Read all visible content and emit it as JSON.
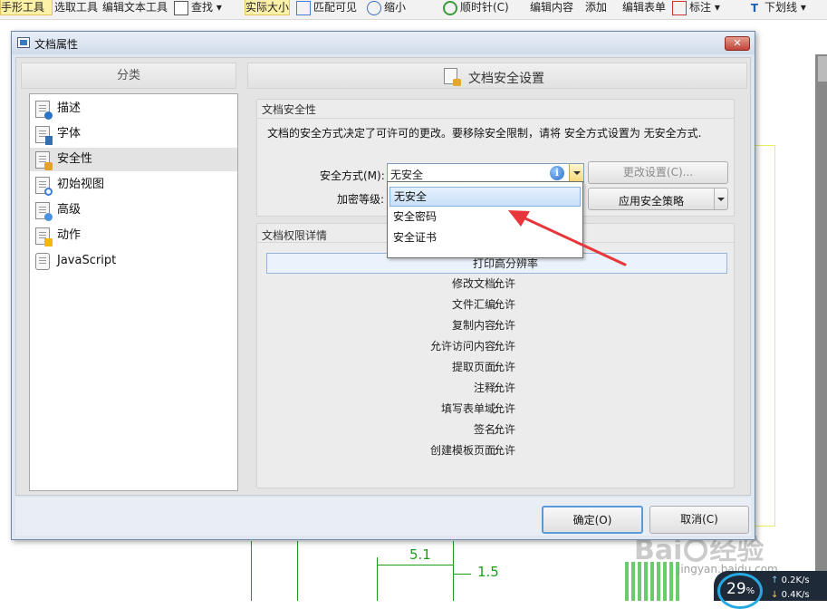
{
  "toolbar": {
    "items": [
      "手形工具",
      "选取工具",
      "编辑文本工具",
      "查找",
      "实际大小",
      "匹配可见",
      "缩小",
      "顺时针(C)",
      "编辑内容",
      "添加",
      "编辑表单",
      "标注",
      "下划线"
    ]
  },
  "dialog": {
    "title": "文档属性",
    "close_label": "✕",
    "left_header": "分类",
    "categories": [
      {
        "label": "描述",
        "icon": "info-document-icon"
      },
      {
        "label": "字体",
        "icon": "font-document-icon"
      },
      {
        "label": "安全性",
        "icon": "lock-document-icon"
      },
      {
        "label": "初始视图",
        "icon": "magnifier-document-icon"
      },
      {
        "label": "高级",
        "icon": "gear-document-icon"
      },
      {
        "label": "动作",
        "icon": "lightning-document-icon"
      },
      {
        "label": "JavaScript",
        "icon": "script-scroll-icon"
      }
    ],
    "selected_category": "安全性",
    "right_header": "文档安全设置",
    "security_group": {
      "title": "文档安全性",
      "description": "文档的安全方式决定了可许可的更改。要移除安全限制，请将 安全方式设置为 无安全方式.",
      "method_label": "安全方式(M):",
      "method_value": "无安全",
      "change_settings_label": "更改设置(C)...",
      "encryption_label": "加密等级:",
      "apply_policy_label": "应用安全策略"
    },
    "dropdown": {
      "options": [
        "无安全",
        "安全密码",
        "安全证书"
      ],
      "selected": "无安全"
    },
    "permissions_group": {
      "title": "文档权限详情",
      "rows": [
        {
          "key": "打印:",
          "value": "高分辨率"
        },
        {
          "key": "修改文档:",
          "value": "允许"
        },
        {
          "key": "文件汇编:",
          "value": "允许"
        },
        {
          "key": "复制内容:",
          "value": "允许"
        },
        {
          "key": "允许访问内容:",
          "value": "允许"
        },
        {
          "key": "提取页面:",
          "value": "允许"
        },
        {
          "key": "注释:",
          "value": "允许"
        },
        {
          "key": "填写表单域:",
          "value": "允许"
        },
        {
          "key": "签名:",
          "value": "允许"
        },
        {
          "key": "创建模板页面:",
          "value": "允许"
        }
      ]
    },
    "ok_label": "确定(O)",
    "cancel_label": "取消(C)"
  },
  "drawing": {
    "dim1": "5.1",
    "dim2": "1.5"
  },
  "watermark": {
    "brand": "Bai",
    "brand2": "经验",
    "url": "jingyan.baidu.com"
  },
  "net_widget": {
    "percent": "29",
    "percent_unit": "%",
    "up_speed": "0.2K/s",
    "down_speed": "0.4K/s"
  },
  "colors": {
    "selection_blue": "#c8e0f8",
    "annotation_arrow": "#e8373a",
    "cad_green": "#1a9e1a"
  }
}
